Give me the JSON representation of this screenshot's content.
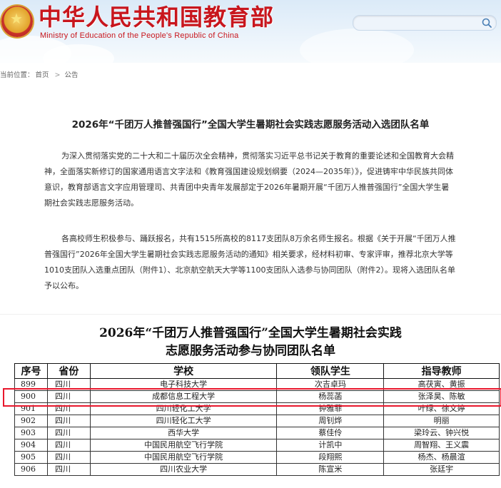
{
  "header": {
    "site_title": "中华人民共和国教育部",
    "site_subtitle": "Ministry of Education of the People's Republic of China",
    "search": {
      "value": "",
      "placeholder": ""
    },
    "icons": [
      "national-emblem-icon",
      "search-icon"
    ]
  },
  "breadcrumb": {
    "label": "当前位置：",
    "home": "首页",
    "separator": ">",
    "current": "公告"
  },
  "article": {
    "title": "2026年“千团万人推普强国行”全国大学生暑期社会实践志愿服务活动入选团队名单",
    "paragraphs": [
      "为深入贯彻落实党的二十大和二十届历次全会精神，贯彻落实习近平总书记关于教育的重要论述和全国教育大会精神，全面落实新修订的国家通用语言文字法和《教育强国建设规划纲要（2024—2035年）》，促进铸牢中华民族共同体意识，教育部语言文字应用管理司、共青团中央青年发展部定于2026年暑期开展“千团万人推普强国行”全国大学生暑期社会实践志愿服务活动。",
      "各高校师生积极参与、踊跃报名，共有1515所高校的8117支团队8万余名师生报名。根据《关于开展“千团万人推普强国行”2026年全国大学生暑期社会实践志愿服务活动的通知》相关要求，经材料初审、专家评审，推荐北京大学等1010支团队入选重点团队（附件1）、北京航空航天大学等1100支团队入选参与协同团队（附件2）。现将入选团队名单予以公布。"
    ]
  },
  "scanned_document": {
    "title_line1": "2026年“千团万人推普强国行”全国大学生暑期社会实践",
    "title_line2": "志愿服务活动参与协同团队名单",
    "columns": [
      "序号",
      "省份",
      "学校",
      "领队学生",
      "指导教师"
    ],
    "rows": [
      [
        "899",
        "四川",
        "电子科技大学",
        "次吉卓玛",
        "高茯寅、黄振"
      ],
      [
        "900",
        "四川",
        "成都信息工程大学",
        "杨蕊菡",
        "张泽昊、陈敏"
      ],
      [
        "901",
        "四川",
        "四川轻化工大学",
        "钟雅菲",
        "叶绿、徐文婷"
      ],
      [
        "902",
        "四川",
        "四川轻化工大学",
        "周钊烨",
        "明丽"
      ],
      [
        "903",
        "四川",
        "西华大学",
        "蔡佳伶",
        "梁玲云、钟兴悦"
      ],
      [
        "904",
        "四川",
        "中国民用航空飞行学院",
        "计凯中",
        "周智翔、王义震"
      ],
      [
        "905",
        "四川",
        "中国民用航空飞行学院",
        "段翔熙",
        "杨杰、杨晨渲"
      ],
      [
        "906",
        "四川",
        "四川农业大学",
        "陈宣米",
        "张廷宇"
      ]
    ],
    "highlighted_row": "900",
    "highlight_color": "#e8172c"
  },
  "colors": {
    "brand_red": "#c8161d",
    "header_sky": "#dbeaf8"
  }
}
